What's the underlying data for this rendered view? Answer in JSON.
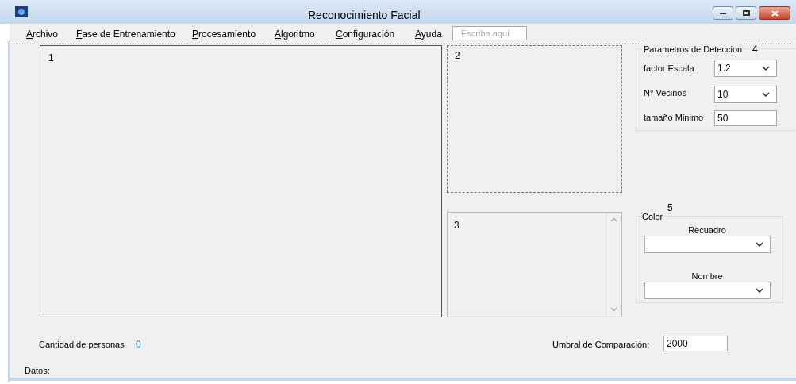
{
  "window": {
    "title": "Reconocimiento Facial"
  },
  "menu": {
    "items": [
      {
        "label": "Archivo"
      },
      {
        "label": "Fase de Entrenamiento"
      },
      {
        "label": "Procesamiento"
      },
      {
        "label": "Algoritmo"
      },
      {
        "label": "Configuración"
      },
      {
        "label": "Ayuda"
      }
    ],
    "placeholder": "Escriba aquí"
  },
  "panels": [
    {
      "label": "1"
    },
    {
      "label": "2"
    },
    {
      "label": "3"
    }
  ],
  "detection": {
    "title": "Parametros de Deteccion",
    "number": "4",
    "fields": [
      {
        "kind": "combo",
        "label": "factor Escala",
        "value": "1.2"
      },
      {
        "kind": "combo",
        "label": "N° Vecinos",
        "value": "10"
      },
      {
        "kind": "text",
        "label": "tamaño Minimo",
        "value": "50"
      }
    ]
  },
  "color": {
    "number": "5",
    "title": "Color",
    "fields": [
      {
        "label": "Recuadro"
      },
      {
        "label": "Nombre"
      }
    ]
  },
  "count": {
    "label": "Cantidad de personas",
    "value": "0"
  },
  "threshold": {
    "label": "Umbral de Comparación:",
    "value": "2000"
  },
  "data_label": "Datos:"
}
